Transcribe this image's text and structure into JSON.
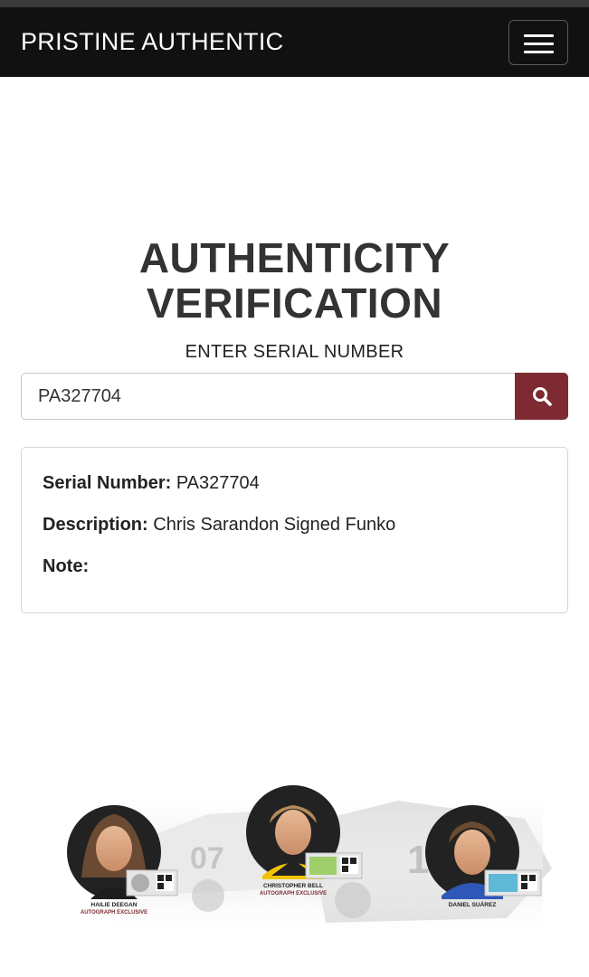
{
  "header": {
    "brand": "PRISTINE AUTHENTIC",
    "menu_icon": "hamburger-menu-icon"
  },
  "hero": {
    "title_line1": "AUTHENTICITY",
    "title_line2": "VERIFICATION",
    "subtitle": "ENTER SERIAL NUMBER"
  },
  "search": {
    "value": "PA327704",
    "button_icon": "search-icon"
  },
  "result": {
    "serial_label": "Serial Number:",
    "serial_value": "PA327704",
    "description_label": "Description:",
    "description_value": "Chris Sarandon Signed Funko",
    "note_label": "Note:",
    "note_value": ""
  },
  "banner": {
    "drivers": [
      {
        "name": "HAILIE DEEGAN",
        "tag": "AUTOGRAPH EXCLUSIVE"
      },
      {
        "name": "CHRISTOPHER BELL",
        "tag": "AUTOGRAPH EXCLUSIVE"
      },
      {
        "name": "DANIEL SUÁREZ",
        "tag": ""
      }
    ],
    "accent_color": "#7d2a33"
  }
}
